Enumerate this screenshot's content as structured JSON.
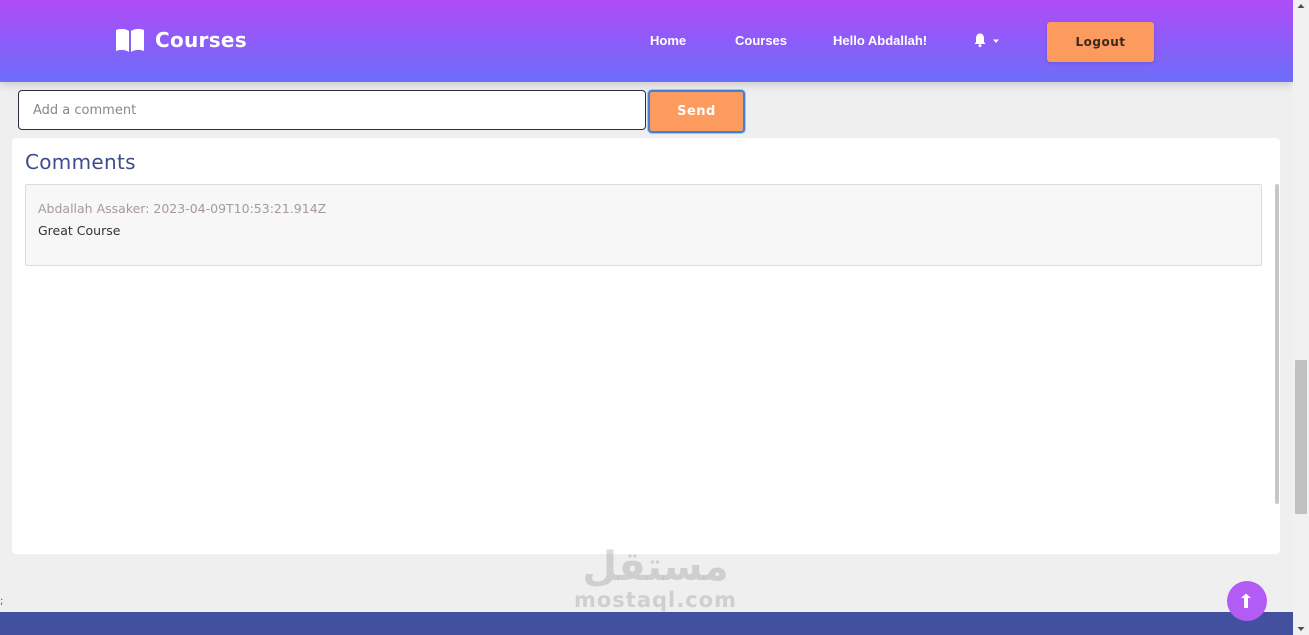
{
  "navbar": {
    "brand": {
      "text": "Courses",
      "icon": "open-book-icon"
    },
    "links": [
      {
        "label": "Home"
      },
      {
        "label": "Courses"
      },
      {
        "label": "Hello Abdallah!"
      }
    ],
    "notifications_icon": "bell-icon",
    "logout_label": "Logout"
  },
  "comment_form": {
    "placeholder": "Add a comment",
    "value": "",
    "send_label": "Send"
  },
  "comments": {
    "title": "Comments",
    "items": [
      {
        "author_and_date": "Abdallah Assaker: 2023-04-09T10:53:21.914Z",
        "text": "Great Course"
      }
    ]
  },
  "watermark": {
    "arabic": "مستقل",
    "latin": "mostaql.com"
  },
  "scroll_top_icon": "arrow-up-icon",
  "edge_glyph": ";",
  "colors": {
    "nav_gradient_top": "#b04cf7",
    "nav_gradient_bottom": "#6c6ef9",
    "accent_orange": "#fd9a5d",
    "title_blue": "#3f4c8c",
    "footer": "#4350a0",
    "scroll_top": "#b25cf5"
  }
}
